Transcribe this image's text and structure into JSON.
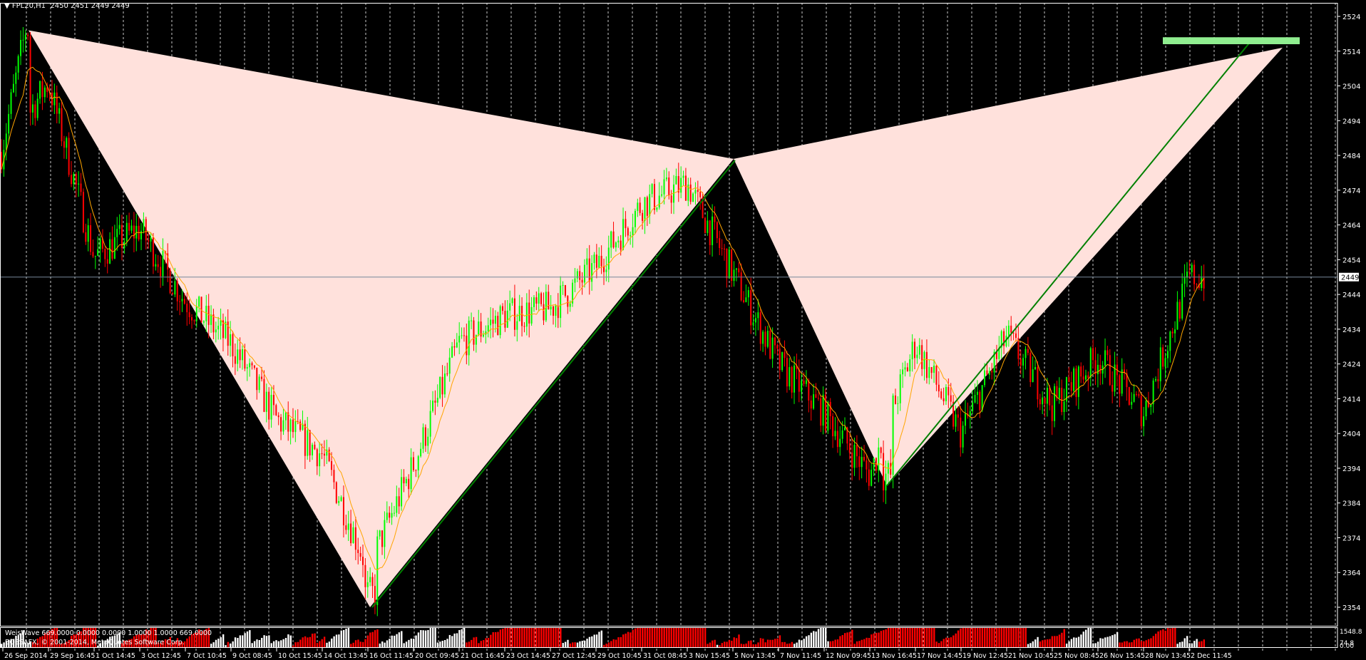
{
  "header": {
    "symbol_line": "FPL20,H1  2450 2451 2449 2449",
    "menu_icon": "triangle-down-icon"
  },
  "volume_panel": {
    "title": "WeisWave 669.0000 0.0000 0.0000 1.0000 1.0000 669.0000",
    "copyright": "BOSSAFX, © 2001-2014, MetaQuotes Software Corp.",
    "scale_labels": [
      "1548.8",
      "74.8",
      "0.00"
    ]
  },
  "colors": {
    "background": "#000000",
    "bull": "#00ff00",
    "bear": "#ff0000",
    "pattern_fill": "#ffe1dc",
    "trend_line": "#008000",
    "target_zone": "#90ee90",
    "moving_average": "#ffa500",
    "volume_up": "#ffffff",
    "volume_down": "#ff0000"
  },
  "chart_data": {
    "type": "candlestick",
    "symbol": "FPL20",
    "timeframe": "H1",
    "current_price": 2449,
    "ylim": [
      2347,
      2528
    ],
    "y_ticks": [
      2524,
      2514,
      2504,
      2494,
      2484,
      2474,
      2464,
      2454,
      2444,
      2434,
      2424,
      2414,
      2404,
      2394,
      2384,
      2374,
      2364,
      2354
    ],
    "x_tick_labels": [
      "26 Sep 2014",
      "29 Sep 16:45",
      "1 Oct 14:45",
      "3 Oct 12:45",
      "7 Oct 10:45",
      "9 Oct 08:45",
      "10 Oct 15:45",
      "14 Oct 13:45",
      "16 Oct 11:45",
      "20 Oct 09:45",
      "21 Oct 16:45",
      "23 Oct 14:45",
      "27 Oct 12:45",
      "29 Oct 10:45",
      "31 Oct 08:45",
      "3 Nov 15:45",
      "5 Nov 13:45",
      "7 Nov 11:45",
      "12 Nov 09:45",
      "13 Nov 16:45",
      "17 Nov 14:45",
      "19 Nov 12:45",
      "21 Nov 10:45",
      "25 Nov 08:45",
      "26 Nov 15:45",
      "28 Nov 13:45",
      "2 Dec 11:45"
    ],
    "approx_price_at_tick": [
      2485,
      2505,
      2455,
      2463,
      2442,
      2430,
      2408,
      2398,
      2365,
      2395,
      2430,
      2438,
      2440,
      2452,
      2470,
      2476,
      2450,
      2424,
      2410,
      2392,
      2430,
      2404,
      2432,
      2412,
      2426,
      2410,
      2449
    ],
    "grid": true,
    "harmonic_pattern": [
      {
        "at": "26 Sep 2014",
        "price": 2520
      },
      {
        "at": "16 Oct 11:45",
        "price": 2354
      },
      {
        "at": "3 Nov 15:45",
        "price": 2483
      },
      {
        "at": "13 Nov 16:45",
        "price": 2389
      },
      {
        "at": "",
        "price": 2515
      }
    ],
    "target_zone_price": [
      2516,
      2518
    ],
    "volume_scale": [
      0,
      1548.8
    ]
  }
}
